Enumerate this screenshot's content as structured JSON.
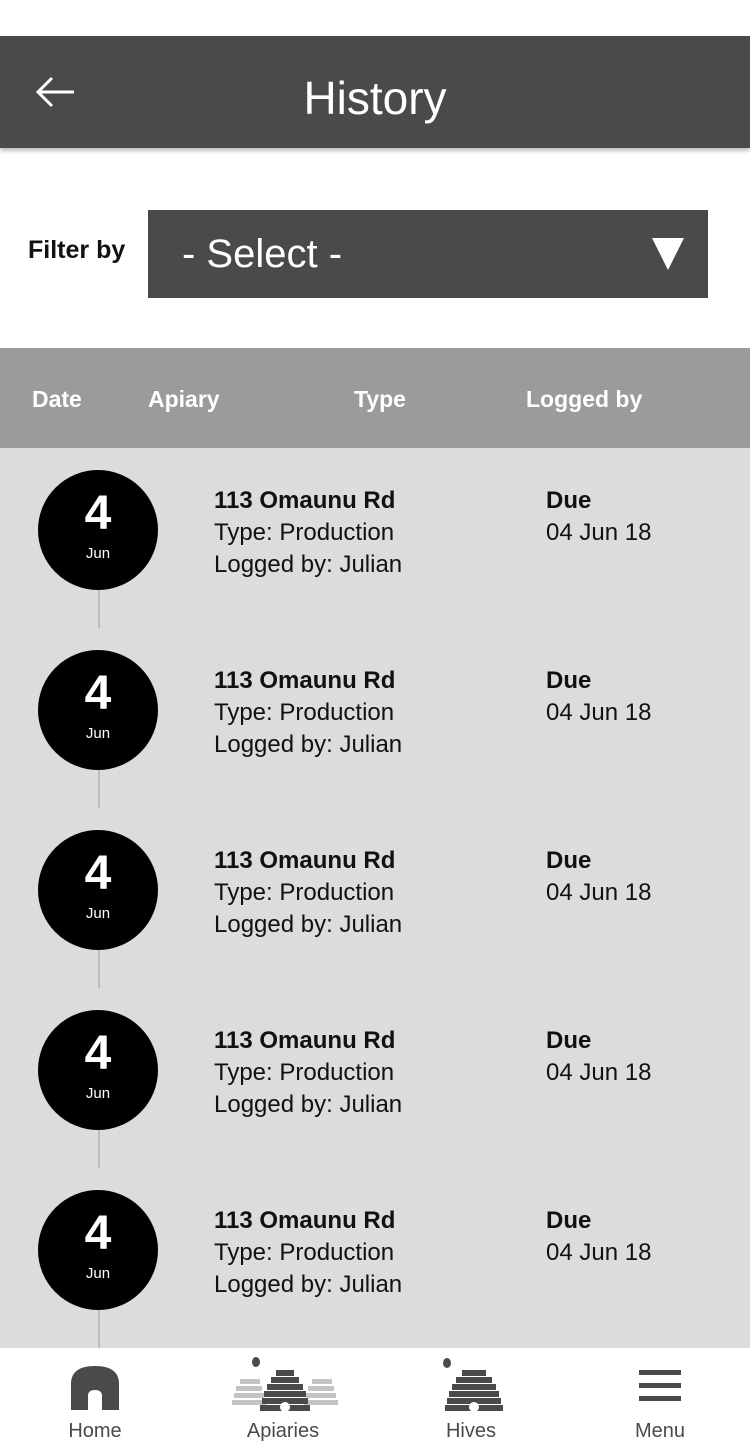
{
  "header": {
    "title": "History",
    "back_icon": "arrow-left-icon"
  },
  "filter": {
    "label": "Filter by",
    "selected": "- Select -",
    "dropdown_icon": "triangle-down-icon"
  },
  "columns": [
    "Date",
    "Apiary",
    "Type",
    "Logged by"
  ],
  "entries": [
    {
      "day": "4",
      "month": "Jun",
      "apiary": "113 Omaunu Rd",
      "type": "Type: Production",
      "logged_by": "Logged by: Julian",
      "status": "Due",
      "date": "04 Jun 18"
    },
    {
      "day": "4",
      "month": "Jun",
      "apiary": "113 Omaunu Rd",
      "type": "Type: Production",
      "logged_by": "Logged by: Julian",
      "status": "Due",
      "date": "04 Jun 18"
    },
    {
      "day": "4",
      "month": "Jun",
      "apiary": "113 Omaunu Rd",
      "type": "Type: Production",
      "logged_by": "Logged by: Julian",
      "status": "Due",
      "date": "04 Jun 18"
    },
    {
      "day": "4",
      "month": "Jun",
      "apiary": "113 Omaunu Rd",
      "type": "Type: Production",
      "logged_by": "Logged by: Julian",
      "status": "Due",
      "date": "04 Jun 18"
    },
    {
      "day": "4",
      "month": "Jun",
      "apiary": "113 Omaunu Rd",
      "type": "Type: Production",
      "logged_by": "Logged by: Julian",
      "status": "Due",
      "date": "04 Jun 18"
    }
  ],
  "tabs": [
    {
      "label": "Home",
      "icon": "home-icon"
    },
    {
      "label": "Apiaries",
      "icon": "beehives-icon"
    },
    {
      "label": "Hives",
      "icon": "beehive-icon"
    },
    {
      "label": "Menu",
      "icon": "hamburger-menu-icon"
    }
  ],
  "colors": {
    "header_bg": "#4a4a4a",
    "table_head_bg": "#9b9b9b",
    "list_bg": "#dcdcdc",
    "circle_bg": "#000000"
  }
}
